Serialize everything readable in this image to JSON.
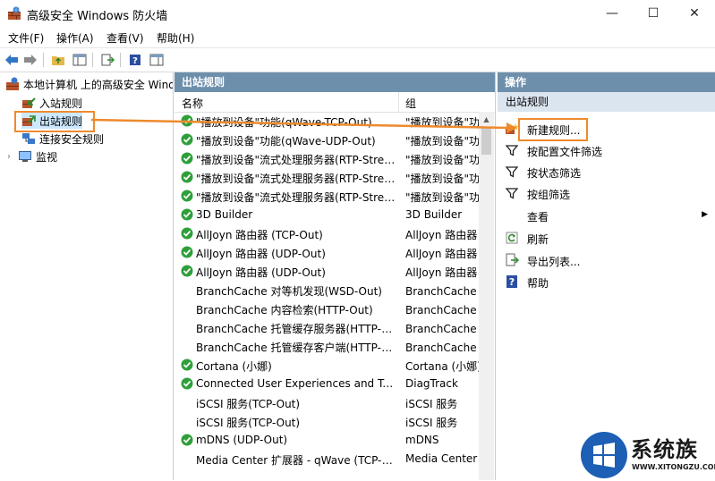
{
  "window": {
    "title": "高级安全 Windows 防火墙",
    "minimize": "—",
    "maximize": "☐",
    "close": "✕"
  },
  "menu": [
    "文件(F)",
    "操作(A)",
    "查看(V)",
    "帮助(H)"
  ],
  "tree": {
    "root": "本地计算机 上的高级安全 Windows 防火墙",
    "items": [
      "入站规则",
      "出站规则",
      "连接安全规则",
      "监视"
    ],
    "selected": "出站规则"
  },
  "center": {
    "title": "出站规则",
    "columns": [
      "名称",
      "组"
    ],
    "rows": [
      {
        "name": "\"播放到设备\"功能(qWave-TCP-Out)",
        "group": "\"播放到设备\"功能",
        "enabled": true
      },
      {
        "name": "\"播放到设备\"功能(qWave-UDP-Out)",
        "group": "\"播放到设备\"功能",
        "enabled": true
      },
      {
        "name": "\"播放到设备\"流式处理服务器(RTP-Streaming-Out)",
        "group": "\"播放到设备\"功能",
        "enabled": true
      },
      {
        "name": "\"播放到设备\"流式处理服务器(RTP-Streaming-Out)",
        "group": "\"播放到设备\"功能",
        "enabled": true
      },
      {
        "name": "\"播放到设备\"流式处理服务器(RTP-Streaming-Out)",
        "group": "\"播放到设备\"功能",
        "enabled": true
      },
      {
        "name": "3D Builder",
        "group": "3D Builder",
        "enabled": true
      },
      {
        "name": "AllJoyn 路由器 (TCP-Out)",
        "group": "AllJoyn 路由器",
        "enabled": true
      },
      {
        "name": "AllJoyn 路由器 (UDP-Out)",
        "group": "AllJoyn 路由器",
        "enabled": true
      },
      {
        "name": "AllJoyn 路由器 (UDP-Out)",
        "group": "AllJoyn 路由器",
        "enabled": true
      },
      {
        "name": "BranchCache 对等机发现(WSD-Out)",
        "group": "BranchCache - 对等机发现",
        "enabled": false
      },
      {
        "name": "BranchCache 内容检索(HTTP-Out)",
        "group": "BranchCache - 内容检索",
        "enabled": false
      },
      {
        "name": "BranchCache 托管缓存服务器(HTTP-Out)",
        "group": "BranchCache - 托管缓存服务器",
        "enabled": false
      },
      {
        "name": "BranchCache 托管缓存客户端(HTTP-Out)",
        "group": "BranchCache - 托管缓存客户端",
        "enabled": false
      },
      {
        "name": "Cortana (小娜)",
        "group": "Cortana (小娜)",
        "enabled": true
      },
      {
        "name": "Connected User Experiences and Telemetry",
        "group": "DiagTrack",
        "enabled": true
      },
      {
        "name": "iSCSI 服务(TCP-Out)",
        "group": "iSCSI 服务",
        "enabled": false
      },
      {
        "name": "iSCSI 服务(TCP-Out)",
        "group": "iSCSI 服务",
        "enabled": false
      },
      {
        "name": "mDNS (UDP-Out)",
        "group": "mDNS",
        "enabled": true
      },
      {
        "name": "Media Center 扩展器 - qWave (TCP-Out)",
        "group": "Media Center",
        "enabled": false
      }
    ]
  },
  "actions": {
    "pane_title": "操作",
    "section": "出站规则",
    "items": [
      "新建规则...",
      "按配置文件筛选",
      "按状态筛选",
      "按组筛选",
      "查看",
      "刷新",
      "导出列表...",
      "帮助"
    ]
  },
  "watermark": {
    "name": "系统族",
    "url": "WWW.XITONGZU.COM"
  },
  "colors": {
    "highlight": "#ee8a2d",
    "pane_header": "#6e8fab",
    "section_bg": "#dbe5ef",
    "enabled_green": "#2e9f3a"
  }
}
